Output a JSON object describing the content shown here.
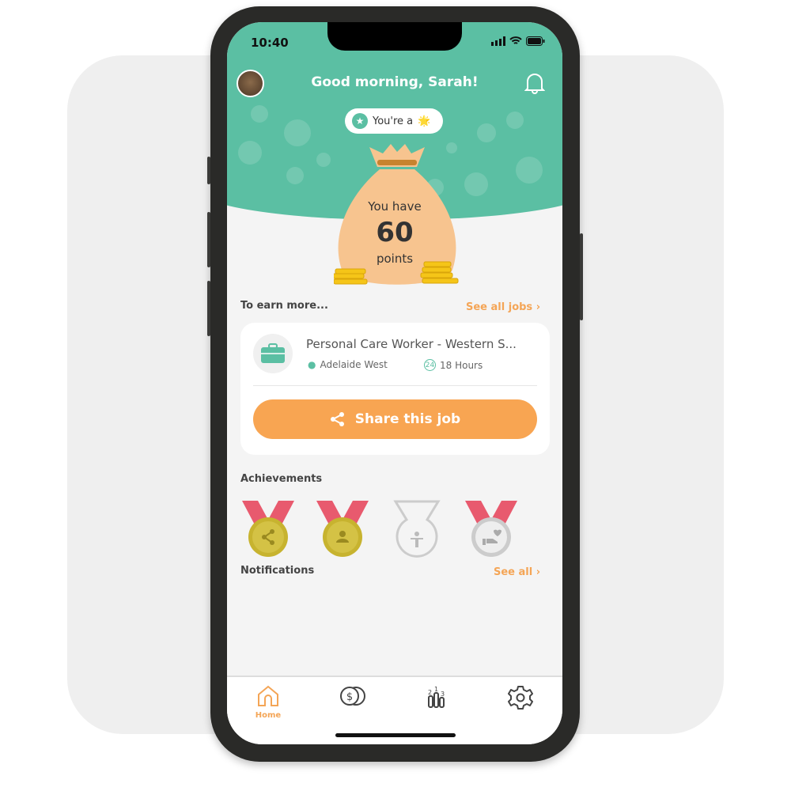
{
  "status_bar": {
    "time": "10:40"
  },
  "header": {
    "greeting": "Good morning, Sarah!",
    "badge_label": "You're a",
    "badge_emoji": "🌟"
  },
  "points": {
    "prefix": "You have",
    "value": "60",
    "unit": "points"
  },
  "earn": {
    "title": "To earn more...",
    "see_all": "See all jobs"
  },
  "job": {
    "title": "Personal Care Worker - Western S...",
    "location": "Adelaide West",
    "hours": "18 Hours",
    "share_label": "Share this job"
  },
  "achievements": {
    "title": "Achievements",
    "medals": [
      {
        "icon": "share-icon",
        "earned": true
      },
      {
        "icon": "person-icon",
        "earned": true
      },
      {
        "icon": "accessibility-icon",
        "earned": false
      },
      {
        "icon": "heart-hand-icon",
        "earned": true,
        "silver": true
      }
    ]
  },
  "notifications": {
    "title": "Notifications",
    "see_all": "See all"
  },
  "tabs": [
    {
      "label": "Home",
      "icon": "home-icon",
      "active": true
    },
    {
      "icon": "coins-icon"
    },
    {
      "icon": "leaderboard-icon"
    },
    {
      "icon": "gear-icon"
    }
  ],
  "colors": {
    "primary": "#5bbfa3",
    "accent": "#f8a552"
  }
}
